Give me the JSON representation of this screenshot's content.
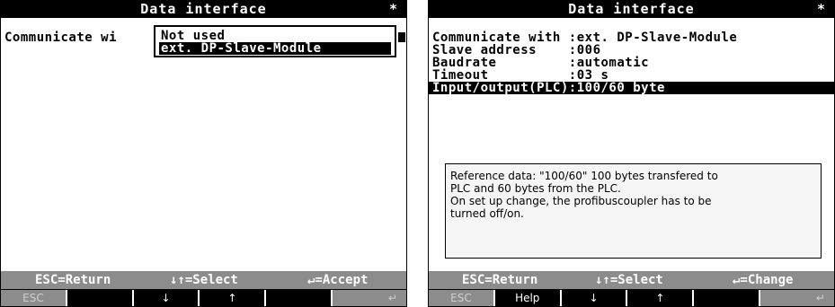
{
  "left_screen": {
    "title": "Data interface",
    "title_mark": "*",
    "parameter_label": "Communicate wi",
    "dropdown": {
      "options": [
        "Not used",
        "ext. DP-Slave-Module"
      ],
      "selected_index": 1
    },
    "status": {
      "esc": "ESC=Return",
      "select": "↓↑=Select",
      "accept": "↵=Accept"
    },
    "softkeys": [
      "ESC",
      "",
      "↓",
      "↑",
      "",
      "↵"
    ]
  },
  "right_screen": {
    "title": "Data interface",
    "title_mark": "*",
    "rows": [
      "Communicate with :ext. DP-Slave-Module",
      "Slave address    :006",
      "Baudrate         :automatic",
      "Timeout          :03 s",
      "Input/output(PLC):100/60 byte"
    ],
    "selected_row": 4,
    "help_lines": [
      "Reference data: \"100/60\" 100 bytes transfered to",
      "PLC and 60 bytes from the PLC.",
      "On set up change, the profibuscoupler has to be",
      "turned off/on."
    ],
    "status": {
      "esc": "ESC=Return",
      "select": "↓↑=Select",
      "change": "↵=Change"
    },
    "softkeys": [
      "ESC",
      "Help",
      "↓",
      "↑",
      "",
      "↵"
    ]
  }
}
